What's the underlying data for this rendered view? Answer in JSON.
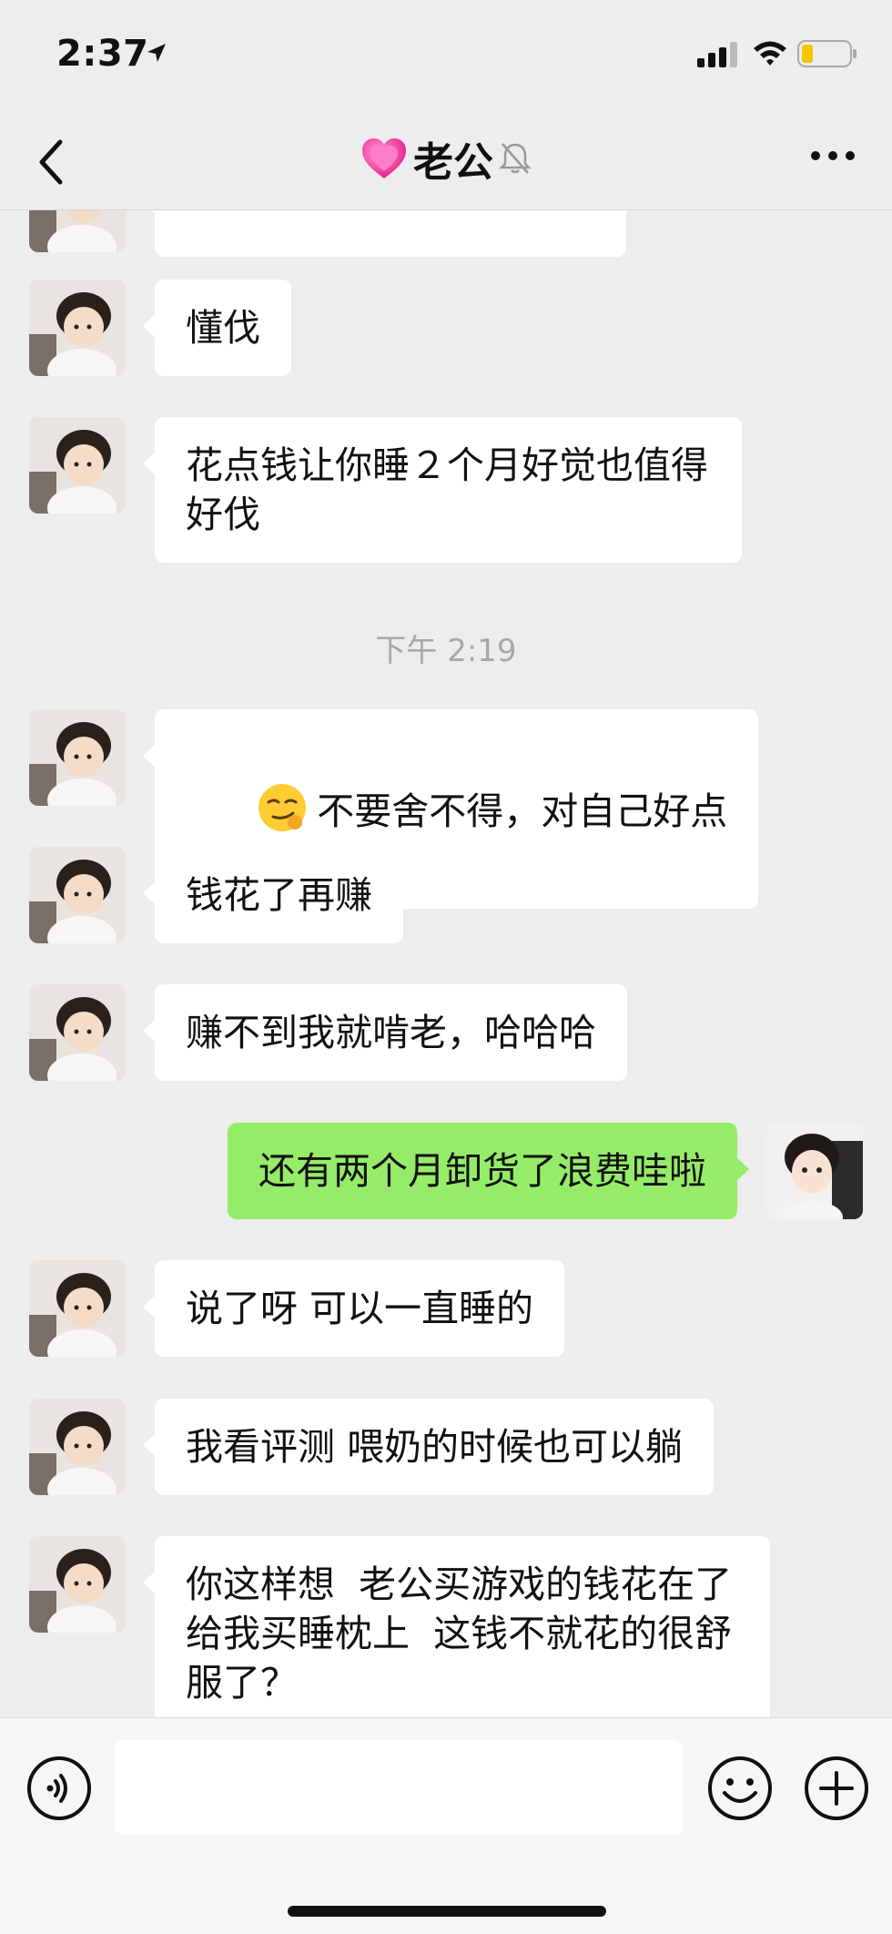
{
  "status_bar": {
    "time": "2:37"
  },
  "header": {
    "title": "老公"
  },
  "chat": {
    "messages": [
      {
        "side": "in",
        "text": ""
      },
      {
        "side": "in",
        "text": "懂伐"
      },
      {
        "side": "in",
        "text": "花点钱让你睡２个月好觉也值得好伐"
      },
      {
        "timestamp": "下午 2:19"
      },
      {
        "side": "in",
        "text": "不要舍不得，对自己好点",
        "emoji": "smirk-face-icon"
      },
      {
        "side": "in",
        "text": "钱花了再赚"
      },
      {
        "side": "in",
        "text": "赚不到我就啃老，哈哈哈"
      },
      {
        "side": "out",
        "text": "还有两个月卸货了浪费哇啦"
      },
      {
        "side": "in",
        "text": "说了呀 可以一直睡的"
      },
      {
        "side": "in",
        "text": "我看评测 喂奶的时候也可以躺"
      },
      {
        "side": "in",
        "text": "你这样想  老公买游戏的钱花在了给我买睡枕上  这钱不就花的很舒服了？"
      }
    ]
  },
  "input_bar": {
    "value": ""
  },
  "colors": {
    "incoming_bubble": "#ffffff",
    "outgoing_bubble": "#95ec69",
    "background": "#ededed"
  }
}
